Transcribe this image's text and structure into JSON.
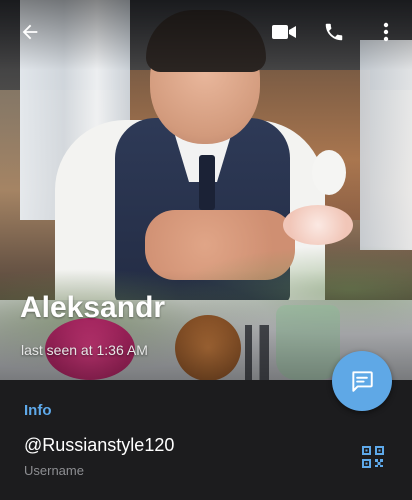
{
  "profile": {
    "name": "Aleksandr",
    "status": "last seen at 1:36 AM"
  },
  "info": {
    "section_title": "Info",
    "username": "@Russianstyle120",
    "username_label": "Username"
  },
  "icons": {
    "back": "back-arrow-icon",
    "video": "video-call-icon",
    "call": "phone-icon",
    "menu": "more-vertical-icon",
    "message": "message-icon",
    "qr": "qr-code-icon"
  },
  "colors": {
    "accent": "#5fa8e6",
    "info_title": "#5ea9ea",
    "panel_bg": "#1c1c1e"
  }
}
